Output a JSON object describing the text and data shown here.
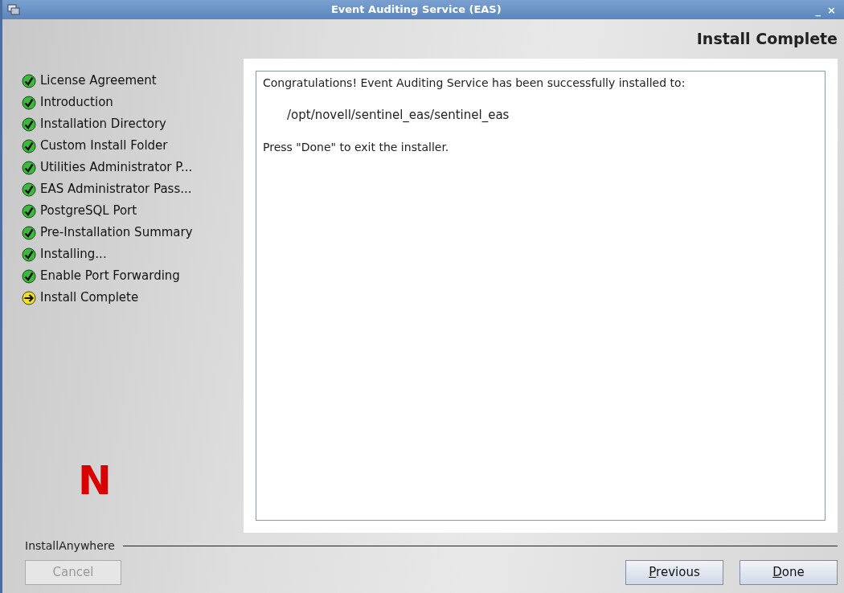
{
  "window": {
    "title": "Event Auditing Service (EAS)",
    "controls": [
      "_",
      "×"
    ]
  },
  "header": {
    "title": "Install Complete"
  },
  "steps": [
    {
      "label": "License Agreement",
      "kind": "done"
    },
    {
      "label": "Introduction",
      "kind": "done"
    },
    {
      "label": "Installation Directory",
      "kind": "done"
    },
    {
      "label": "Custom Install Folder",
      "kind": "done"
    },
    {
      "label": "Utilities Administrator P...",
      "kind": "done"
    },
    {
      "label": "EAS Administrator Pass...",
      "kind": "done"
    },
    {
      "label": "PostgreSQL Port",
      "kind": "done"
    },
    {
      "label": "Pre-Installation Summary",
      "kind": "done"
    },
    {
      "label": "Installing...",
      "kind": "done"
    },
    {
      "label": "Enable Port Forwarding",
      "kind": "done"
    },
    {
      "label": "Install Complete",
      "kind": "current"
    }
  ],
  "logo": {
    "text": "N"
  },
  "content": {
    "lines": [
      "Congratulations! Event Auditing Service has been successfully installed to:",
      "/opt/novell/sentinel_eas/sentinel_eas",
      "Press \"Done\" to exit the installer."
    ]
  },
  "footer": {
    "label": "InstallAnywhere"
  },
  "buttons": [
    {
      "label": "Cancel",
      "disabled": true,
      "mnemonic": false
    },
    {
      "label": "Previous",
      "disabled": false,
      "mnemonic": true
    },
    {
      "label": "Done",
      "disabled": false,
      "mnemonic": true
    }
  ]
}
